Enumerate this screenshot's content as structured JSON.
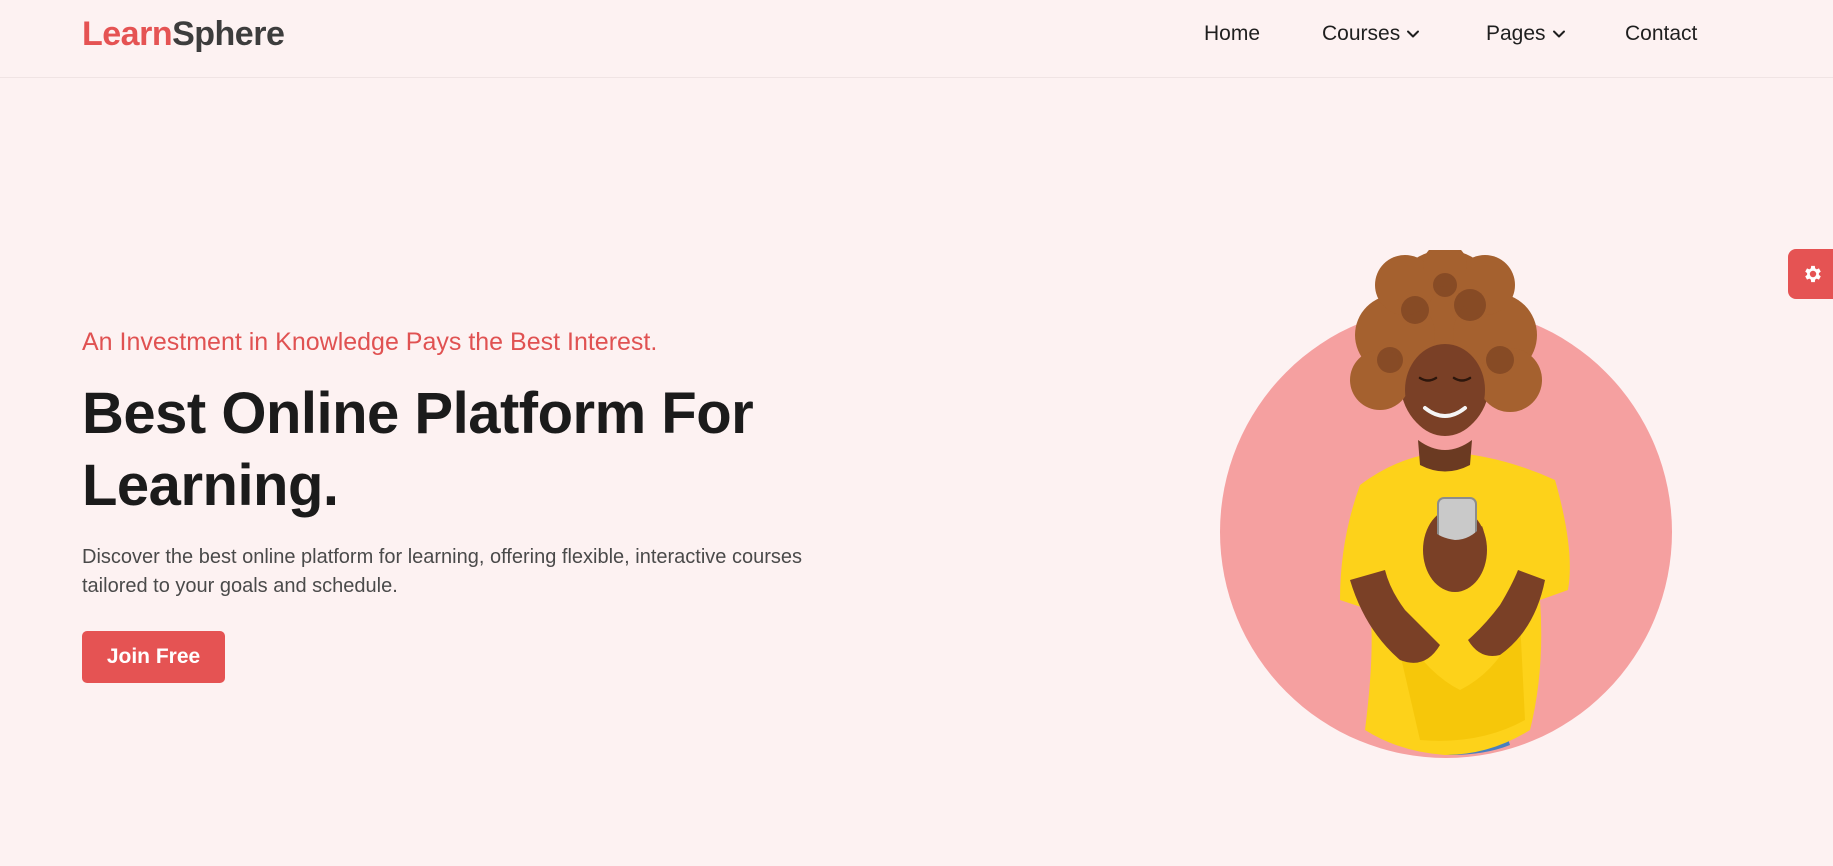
{
  "brand": {
    "logo_part1": "Learn",
    "logo_part2": "Sphere",
    "accent_color": "#e55353",
    "dark_color": "#3d3d3d"
  },
  "nav": {
    "home": "Home",
    "courses": "Courses",
    "pages": "Pages",
    "contact": "Contact"
  },
  "hero": {
    "tagline": "An Investment in Knowledge Pays the Best Interest.",
    "headline_line1": "Best Online Platform For",
    "headline_line2": "Learning.",
    "description": "Discover the best online platform for learning, offering flexible, interactive courses tailored to your goals and schedule.",
    "cta_label": "Join Free"
  },
  "icons": {
    "settings": "gear-icon",
    "dropdown": "chevron-down-icon"
  }
}
